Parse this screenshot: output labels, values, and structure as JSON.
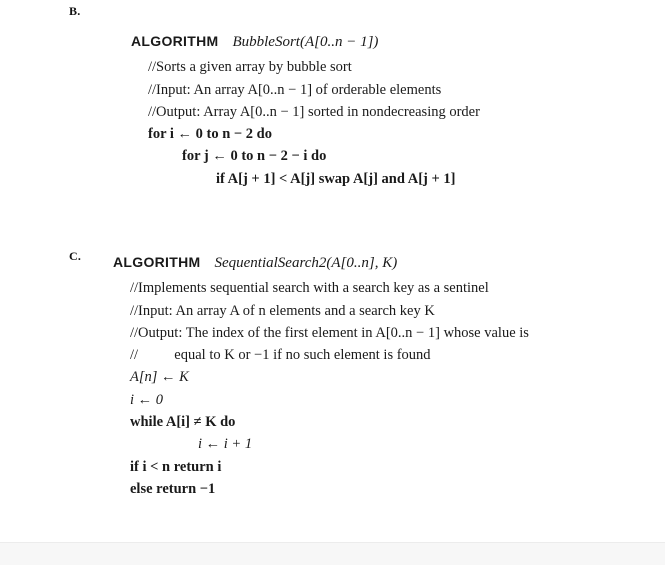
{
  "page": {
    "background_color": "#ffffff",
    "text_color": "#1a1a1a",
    "footer_band_color": "#f7f7f7"
  },
  "sections": [
    {
      "label": "B.",
      "algorithm": {
        "keyword": "ALGORITHM",
        "signature": "BubbleSort(A[0..n − 1])",
        "lines": [
          "//Sorts a given array by bubble sort",
          "//Input: An array A[0..n − 1] of orderable elements",
          "//Output: Array A[0..n − 1] sorted in nondecreasing order",
          "for i ← 0 to n − 2 do",
          "for j ← 0 to n − 2 − i do",
          "if A[j + 1] < A[j] swap A[j] and A[j + 1]"
        ]
      }
    },
    {
      "label": "C.",
      "algorithm": {
        "keyword": "ALGORITHM",
        "signature": "SequentialSearch2(A[0..n], K)",
        "lines": [
          "//Implements sequential search with a search key as a sentinel",
          "//Input: An array A of n elements and a search key K",
          "//Output: The index of the first element in A[0..n − 1] whose value is",
          "//          equal to K or −1 if no such element is found",
          "A[n] ← K",
          "i ← 0",
          "while A[i] ≠ K do",
          "i ← i + 1",
          "if i < n return i",
          "else return −1"
        ]
      }
    }
  ]
}
